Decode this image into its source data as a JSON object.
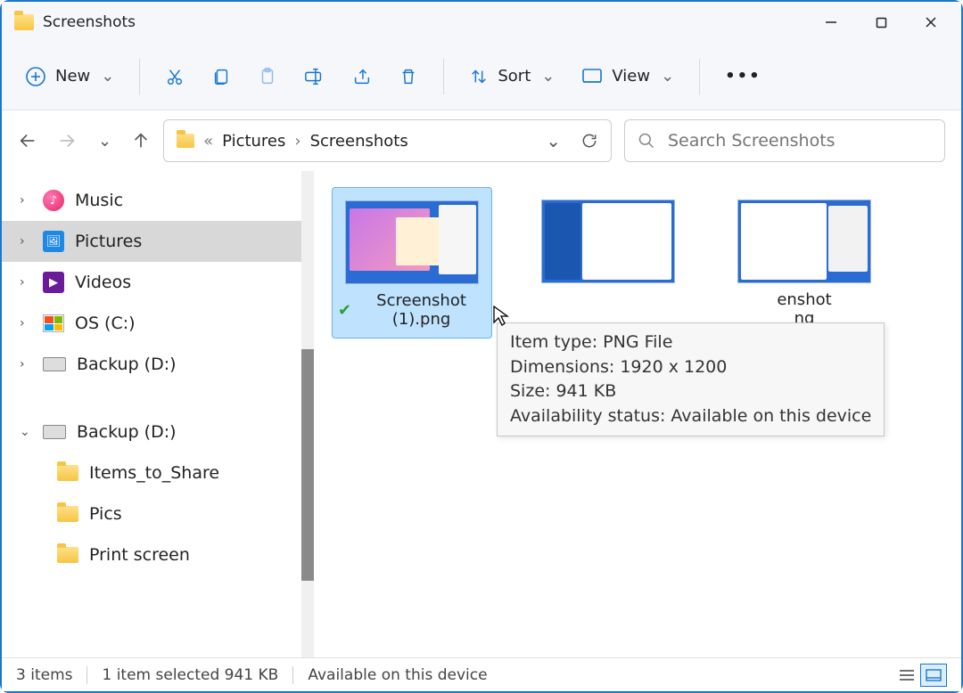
{
  "window": {
    "title": "Screenshots"
  },
  "toolbar": {
    "new_label": "New",
    "sort_label": "Sort",
    "view_label": "View"
  },
  "breadcrumb": {
    "part1": "Pictures",
    "part2": "Screenshots"
  },
  "search": {
    "placeholder": "Search Screenshots"
  },
  "sidebar": {
    "music": "Music",
    "pictures": "Pictures",
    "videos": "Videos",
    "os": "OS (C:)",
    "backup1": "Backup (D:)",
    "backup2": "Backup (D:)",
    "items_to_share": "Items_to_Share",
    "pics": "Pics",
    "print_screen": "Print screen"
  },
  "files": [
    {
      "name": "Screenshot (1).png",
      "selected": true,
      "synced": true
    },
    {
      "name": ""
    },
    {
      "name_part1": "enshot",
      "name_part2": "ng"
    }
  ],
  "tooltip": {
    "line1": "Item type: PNG File",
    "line2": "Dimensions: 1920 x 1200",
    "line3": "Size: 941 KB",
    "line4": "Availability status: Available on this device"
  },
  "status": {
    "count": "3 items",
    "selection": "1 item selected  941 KB",
    "availability": "Available on this device"
  }
}
